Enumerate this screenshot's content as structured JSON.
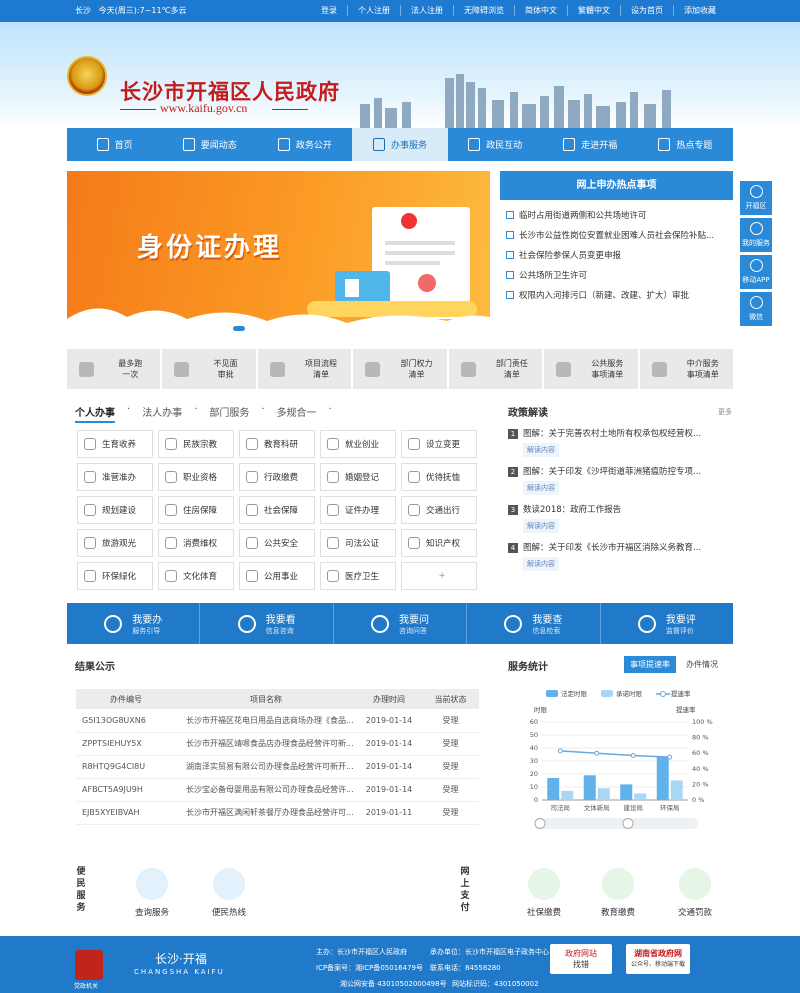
{
  "topbar": {
    "city": "长沙",
    "today": "今天(周三):",
    "weather": "7~11℃多云",
    "links": [
      "登录",
      "个人注册",
      "法人注册",
      "无障碍浏览",
      "简体中文",
      "繁體中文",
      "设为首页",
      "添加收藏"
    ]
  },
  "header": {
    "title": "长沙市开福区人民政府",
    "domain": "www.kaifu.gov.cn"
  },
  "nav": [
    {
      "label": "首页",
      "icon": "home-icon"
    },
    {
      "label": "要闻动态",
      "icon": "news-icon"
    },
    {
      "label": "政务公开",
      "icon": "book-icon"
    },
    {
      "label": "办事服务",
      "icon": "user-service-icon",
      "active": true
    },
    {
      "label": "政民互动",
      "icon": "chat-icon"
    },
    {
      "label": "走进开福",
      "icon": "image-icon"
    },
    {
      "label": "热点专题",
      "icon": "drop-icon"
    }
  ],
  "banner": {
    "text": "身份证办理"
  },
  "hot": {
    "title": "网上申办热点事项",
    "items": [
      "临时占用街道两侧和公共场地许可",
      "长沙市公益性岗位安置就业困难人员社会保险补贴...",
      "社会保险参保人员变更申报",
      "公共场所卫生许可",
      "权限内入河排污口（新建、改建、扩大）审批"
    ]
  },
  "side": [
    {
      "label": "开福区"
    },
    {
      "label": "我的服务"
    },
    {
      "label": "移动APP"
    },
    {
      "label": "微信"
    }
  ],
  "quick": [
    [
      "最多跑",
      "一次"
    ],
    [
      "不见面",
      "审批"
    ],
    [
      "项目流程",
      "清单"
    ],
    [
      "部门权力",
      "清单"
    ],
    [
      "部门责任",
      "清单"
    ],
    [
      "公共服务",
      "事项清单"
    ],
    [
      "中介服务",
      "事项清单"
    ]
  ],
  "service_tabs": [
    "个人办事",
    "法人办事",
    "部门服务",
    "多规合一"
  ],
  "grid": [
    "生育收养",
    "民族宗教",
    "教育科研",
    "就业创业",
    "设立变更",
    "准营准办",
    "职业资格",
    "行政缴费",
    "婚姻登记",
    "优待抚恤",
    "规划建设",
    "住房保障",
    "社会保障",
    "证件办理",
    "交通出行",
    "旅游观光",
    "消费维权",
    "公共安全",
    "司法公证",
    "知识产权",
    "环保绿化",
    "文化体育",
    "公用事业",
    "医疗卫生",
    "+"
  ],
  "policy": {
    "title": "政策解读",
    "more": "更多",
    "jd": "解读内容",
    "items": [
      "图解：关于完善农村土地所有权承包权经营权...",
      "图解：关于印发《沙坪街道菲洲猪瘟防控专项...",
      "数读2018：政府工作报告",
      "图解：关于印发《长沙市开福区消除义务教育..."
    ]
  },
  "bluebar": [
    [
      "我要办",
      "服务引导"
    ],
    [
      "我要看",
      "信息咨询"
    ],
    [
      "我要问",
      "咨询问答"
    ],
    [
      "我要查",
      "信息检索"
    ],
    [
      "我要评",
      "监督评价"
    ]
  ],
  "results": {
    "title": "结果公示",
    "headers": [
      "办件编号",
      "项目名称",
      "办理时间",
      "当前状态"
    ],
    "rows": [
      [
        "G5I13OG8UXN6",
        "长沙市开福区花电日用品自选商场办理《食品...",
        "2019-01-14",
        "受理"
      ],
      [
        "ZPPTSIEHUY5X",
        "长沙市开福区靖嗯食品店办理食品经营许可新...",
        "2019-01-14",
        "受理"
      ],
      [
        "R8HTQ9G4CI8U",
        "湖南泽实贸易有限公司办理食品经营许可新开...",
        "2019-01-14",
        "受理"
      ],
      [
        "AFBCT5A9JU9H",
        "长沙宝必备母婴用品有限公司办理食品经营许...",
        "2019-01-14",
        "受理"
      ],
      [
        "EJB5XYEIBVAH",
        "长沙市开福区满闲轩茶餐厅办理食品经营许可...",
        "2019-01-11",
        "受理"
      ]
    ]
  },
  "stats": {
    "title": "服务统计",
    "tab1": "事项提速率",
    "tab2": "办件情况",
    "legend": [
      "法定时限",
      "承诺时限",
      "提速率"
    ],
    "ylabel": "时限",
    "y2label": "提速率"
  },
  "chart_data": {
    "type": "bar",
    "categories": [
      "司法局",
      "文体新局",
      "建设局",
      "环保局"
    ],
    "series": [
      {
        "name": "法定时限",
        "values": [
          17,
          19,
          12,
          33
        ]
      },
      {
        "name": "承诺时限",
        "values": [
          7,
          9,
          5,
          15
        ]
      },
      {
        "name": "提速率",
        "type": "line",
        "values": [
          63,
          60,
          57,
          55
        ]
      }
    ],
    "ylim": [
      0,
      60
    ],
    "y2lim": [
      0,
      100
    ],
    "yticks": [
      "0",
      "10",
      "20",
      "30",
      "40",
      "50",
      "60"
    ],
    "y2ticks": [
      "0 %",
      "20 %",
      "40 %",
      "60 %",
      "80 %",
      "100 %"
    ]
  },
  "bottom": {
    "left_label": "便民服务",
    "right_label": "网上支付",
    "left": [
      "查询服务",
      "便民热线"
    ],
    "right": [
      "社保缴费",
      "教育缴费",
      "交通罚款"
    ]
  },
  "footer": {
    "logo1": "长沙·开福",
    "logo2": "CHANGSHA KAIFU",
    "host": "主办：长沙市开福区人民政府",
    "undertake": "承办单位：长沙市开福区电子政务中心",
    "icp": "ICP备案号：湘ICP备05016479号",
    "phone": "联系电话：84558280",
    "police": "湘公网安备 43010502000498号",
    "siteid": "网站标识码：4301050002",
    "badge1": "政府网站",
    "badge1b": "找错",
    "badge2": "湖南省政府网",
    "badge2b": "公众号、移动端下载",
    "seal": "党政机关"
  }
}
